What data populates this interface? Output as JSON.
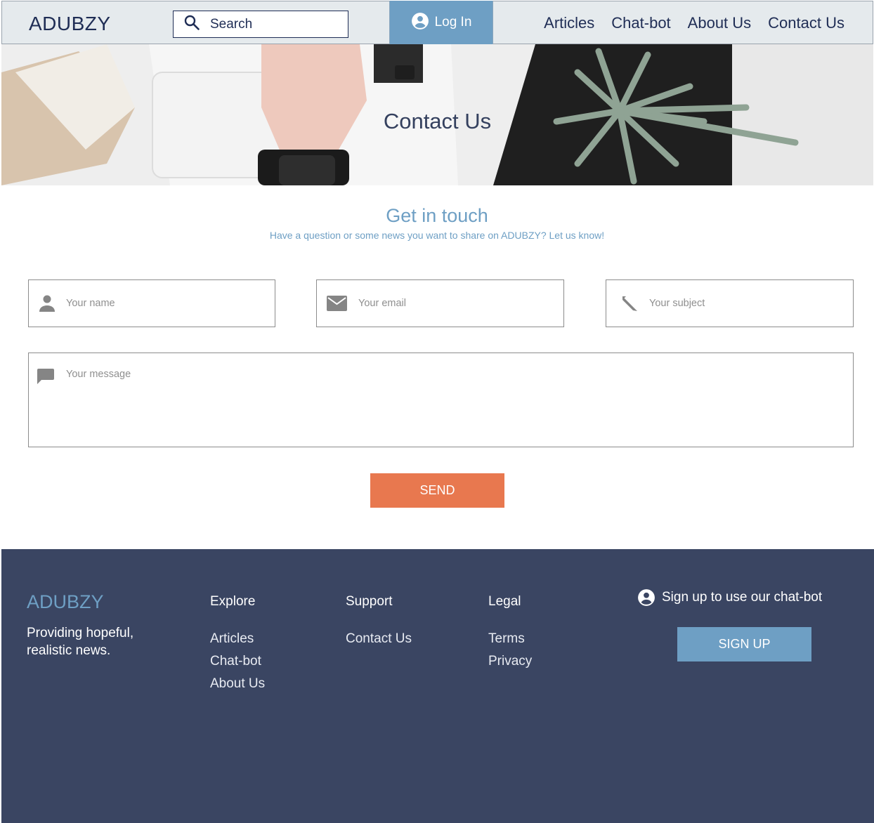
{
  "header": {
    "brand": "ADUBZY",
    "search_label": "Search",
    "login_label": "Log In",
    "nav": [
      "Articles",
      "Chat-bot",
      "About Us",
      "Contact Us"
    ]
  },
  "hero": {
    "title": "Contact Us"
  },
  "contact": {
    "title": "Get in touch",
    "subtitle": "Have a question or some news you want to share on ADUBZY? Let us know!",
    "name_placeholder": "Your name",
    "email_placeholder": "Your email",
    "subject_placeholder": "Your subject",
    "message_placeholder": "Your message",
    "send_label": "SEND"
  },
  "footer": {
    "brand": "ADUBZY",
    "tagline": "Providing hopeful, realistic news.",
    "explore": {
      "heading": "Explore",
      "links": [
        "Articles",
        "Chat-bot",
        "About Us"
      ]
    },
    "support": {
      "heading": "Support",
      "links": [
        "Contact Us"
      ]
    },
    "legal": {
      "heading": "Legal",
      "links": [
        "Terms",
        "Privacy"
      ]
    },
    "signup_text": "Sign up to use our chat-bot",
    "signup_label": "SIGN UP"
  },
  "colors": {
    "accent": "#6e9fc4",
    "send": "#e8784f",
    "footer_bg": "#3a4562",
    "navy": "#1f2d55"
  }
}
